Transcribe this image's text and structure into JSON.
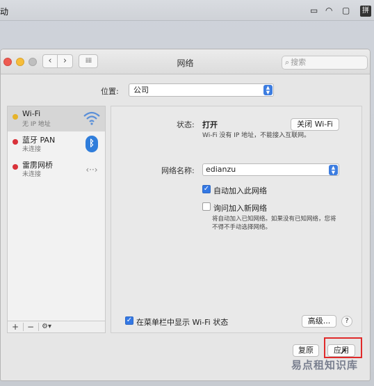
{
  "menubar": {
    "app_fragment": "动",
    "ime_label": "拼",
    "icons": [
      "airplay-icon",
      "wifi-icon",
      "display-icon"
    ]
  },
  "window": {
    "title": "网络",
    "search_placeholder": "搜索"
  },
  "location": {
    "label": "位置:",
    "value": "公司"
  },
  "services": [
    {
      "name": "Wi-Fi",
      "status": "无 IP 地址",
      "dot_color": "#e6b32a",
      "icon": "wifi-icon",
      "selected": true
    },
    {
      "name": "蓝牙 PAN",
      "status": "未连接",
      "dot_color": "#d9323a",
      "icon": "bluetooth-icon",
      "selected": false
    },
    {
      "name": "雷雳网桥",
      "status": "未连接",
      "dot_color": "#d9323a",
      "icon": "bridge-icon",
      "selected": false
    }
  ],
  "sidebar_tools": {
    "add": "+",
    "remove": "−",
    "gear": "⚙︎▾"
  },
  "detail": {
    "status_label": "状态:",
    "status_value": "打开",
    "toggle_button": "关闭 Wi-Fi",
    "status_desc": "Wi-Fi 没有 IP 地址，不能接入互联网。",
    "network_name_label": "网络名称:",
    "network_name_value": "edianzu",
    "auto_join_label": "自动加入此网络",
    "auto_join_checked": true,
    "ask_join_label": "询问加入新网络",
    "ask_join_checked": false,
    "ask_join_note_1": "将自动加入已知网络。如果没有已知网络，您将",
    "ask_join_note_2": "不得不手动选择网络。"
  },
  "footer": {
    "show_menubar_label": "在菜单栏中显示 Wi-Fi 状态",
    "show_menubar_checked": true,
    "advanced_button": "高级...",
    "help_button": "?",
    "revert_button": "复原",
    "apply_button": "应用",
    "watermark": "易点租知识库"
  },
  "colors": {
    "accent": "#3478e4",
    "highlight_box": "#e02a2a"
  }
}
